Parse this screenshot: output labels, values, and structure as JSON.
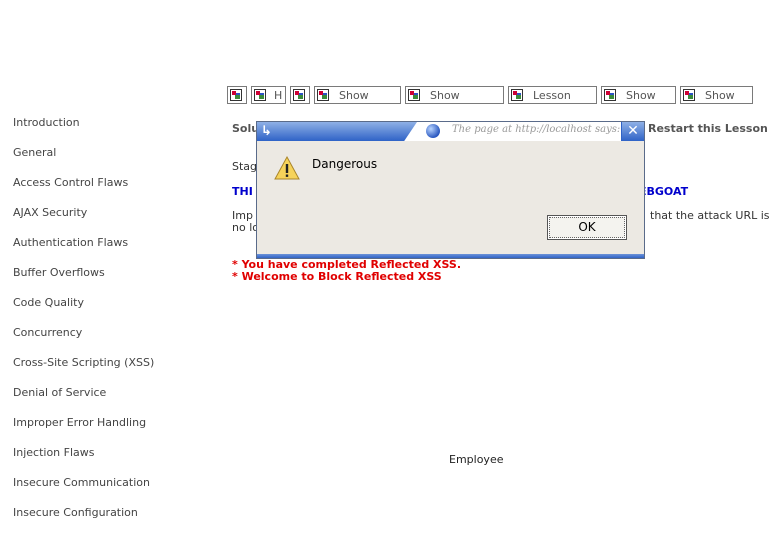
{
  "sidebar": {
    "items": [
      "Introduction",
      "General",
      "Access Control Flaws",
      "AJAX Security",
      "Authentication Flaws",
      "Buffer Overflows",
      "Code Quality",
      "Concurrency",
      "Cross-Site Scripting (XSS)",
      "Denial of Service",
      "Improper Error Handling",
      "Injection Flaws",
      "Insecure Communication",
      "Insecure Configuration"
    ]
  },
  "toolbar": {
    "buttons": [
      "",
      "H",
      "",
      "Show",
      "Show",
      "Lesson",
      "Show",
      "Show"
    ]
  },
  "lesson": {
    "solution_prefix": "Solu",
    "restart_label": "Restart this Lesson",
    "stage_prefix": "Stag",
    "blue_heading_left": "THI",
    "blue_heading_right": "EBGOAT",
    "body_left_1": "Imp",
    "body_left_2": "no lo",
    "body_right_1": "that the attack URL is",
    "completed_msg": "* You have completed Reflected XSS.",
    "welcome_msg": "* Welcome to Block Reflected XSS",
    "employee_label": "Employee"
  },
  "dialog": {
    "title": "The page at http://localhost says:",
    "message": "Dangerous",
    "ok_label": "OK",
    "icons": {
      "warning": "warning-icon",
      "close": "close-icon",
      "globe": "globe-icon"
    }
  }
}
